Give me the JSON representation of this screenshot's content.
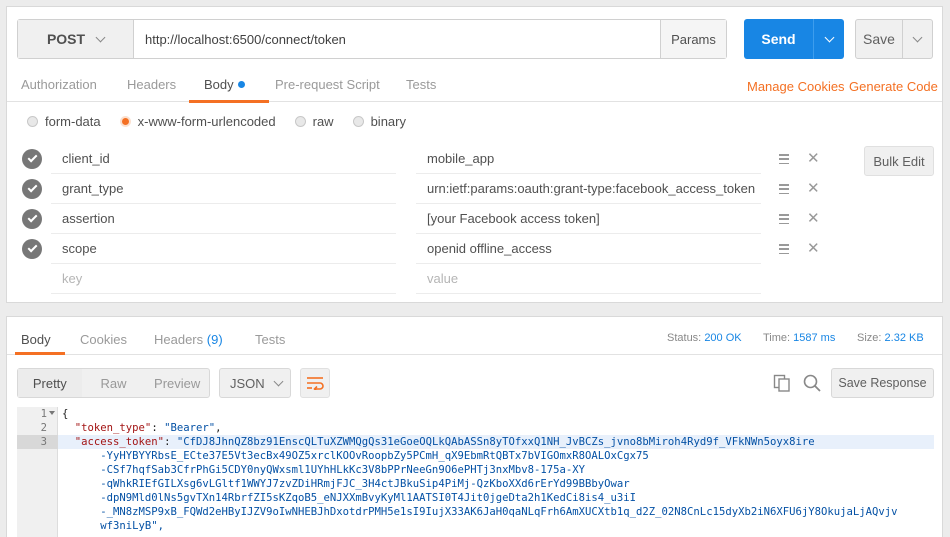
{
  "request": {
    "method": "POST",
    "url": "http://localhost:6500/connect/token",
    "params_label": "Params",
    "send_label": "Send",
    "save_label": "Save",
    "tabs": [
      {
        "label": "Authorization"
      },
      {
        "label": "Headers"
      },
      {
        "label": "Body"
      },
      {
        "label": "Pre-request Script"
      },
      {
        "label": "Tests"
      }
    ],
    "links": {
      "manage_cookies": "Manage Cookies",
      "generate_code": "Generate Code"
    },
    "body_types": [
      {
        "label": "form-data"
      },
      {
        "label": "x-www-form-urlencoded"
      },
      {
        "label": "raw"
      },
      {
        "label": "binary"
      }
    ],
    "selected_body_type": "x-www-form-urlencoded",
    "rows": [
      {
        "key": "client_id",
        "value": "mobile_app"
      },
      {
        "key": "grant_type",
        "value": "urn:ietf:params:oauth:grant-type:facebook_access_token"
      },
      {
        "key": "assertion",
        "value": "[your Facebook access token]"
      },
      {
        "key": "scope",
        "value": "openid offline_access"
      }
    ],
    "key_placeholder": "key",
    "value_placeholder": "value",
    "bulk_edit_label": "Bulk Edit"
  },
  "response": {
    "tabs": [
      {
        "label": "Body"
      },
      {
        "label": "Cookies"
      },
      {
        "label": "Headers",
        "count": "(9)"
      },
      {
        "label": "Tests"
      }
    ],
    "status_label": "Status:",
    "status_value": "200 OK",
    "time_label": "Time:",
    "time_value": "1587 ms",
    "size_label": "Size:",
    "size_value": "2.32 KB",
    "views": [
      {
        "label": "Pretty"
      },
      {
        "label": "Raw"
      },
      {
        "label": "Preview"
      }
    ],
    "format": "JSON",
    "save_response_label": "Save Response",
    "line_numbers": [
      "1",
      "2",
      "3"
    ],
    "code": {
      "open_brace": "{",
      "token_type_key": "\"token_type\"",
      "token_type_value": "\"Bearer\"",
      "access_token_key": "\"access_token\"",
      "access_token_lines": [
        "\"CfDJ8JhnQZ8bz91EnscQLTuXZWMQgQs31eGoeOQLkQAbASSn8yTOfxxQ1NH_JvBCZs_jvno8bMiroh4Ryd9f_VFkNWn5oyx8ire",
        "-YyHYBYYRbsE_ECte37E5Vt3ecBx49OZ5xrclKOOvRoopbZy5PCmH_qX9EbmRtQBTx7bVIGOmxR8OALOxCgx75",
        "-CSf7hqfSab3CfrPhGi5CDY0nyQWxsml1UYhHLkKc3V8bPPrNeeGn9O6ePHTj3nxMbv8-175a-XY",
        "-qWhkRIEfGILXsg6vLGltf1WWYJ7zvZDiHRmjFJC_3H4ctJBkuSip4PiMj-QzKboXXd6rErYd99BBbyOwar",
        "-dpN9Mld0lNs5gvTXn14RbrfZI5sKZqoB5_eNJXXmBvyKyMl1AATSI0T4Jit0jgeDta2h1KedCi8is4_u3iI",
        "-_MN8zMSP9xB_FQWd2eHByIJZV9oIwNHEBJhDxotdrPMH5e1sI9IujX33AK6JaH0qaNLqFrh6AmXUCXtb1q_d2Z_02N8CnLc15dyXb2iN6XFU6jY8OkujaLjAQvjv",
        "wf3niLyB\","
      ]
    }
  }
}
